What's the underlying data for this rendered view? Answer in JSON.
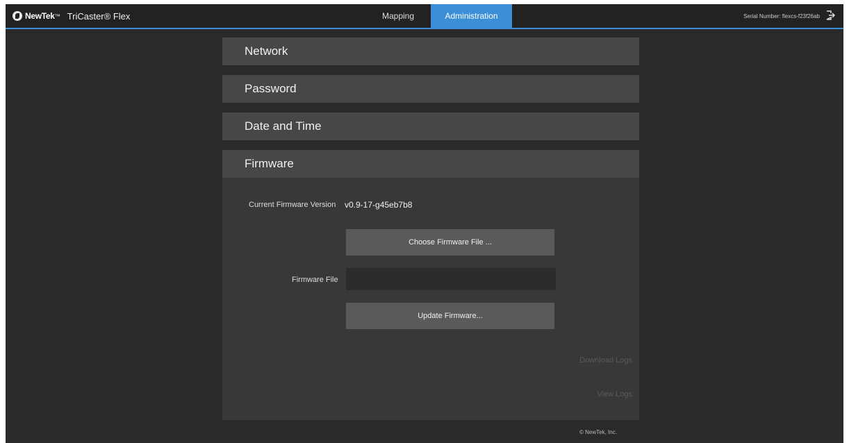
{
  "header": {
    "brand": "NewTek",
    "brand_tm": "™",
    "product": "TriCaster® Flex",
    "tabs": [
      {
        "label": "Mapping",
        "active": false
      },
      {
        "label": "Administration",
        "active": true
      }
    ],
    "serial": "Serial Number: flexcs-f23f26ab",
    "accent_color": "#3b8fd6"
  },
  "panels": {
    "network": "Network",
    "password": "Password",
    "datetime": "Date and Time",
    "firmware": "Firmware"
  },
  "firmware": {
    "current_label": "Current Firmware Version",
    "current_value": "v0.9-17-g45eb7b8",
    "choose_button": "Choose Firmware File ...",
    "file_label": "Firmware File",
    "file_value": "",
    "update_button": "Update Firmware...",
    "download_logs": "Download Logs",
    "view_logs": "View Logs"
  },
  "footer": {
    "copyright": "© NewTek, Inc."
  },
  "icons": {
    "logo": "newtek-logo-icon",
    "logout": "logout-icon"
  }
}
